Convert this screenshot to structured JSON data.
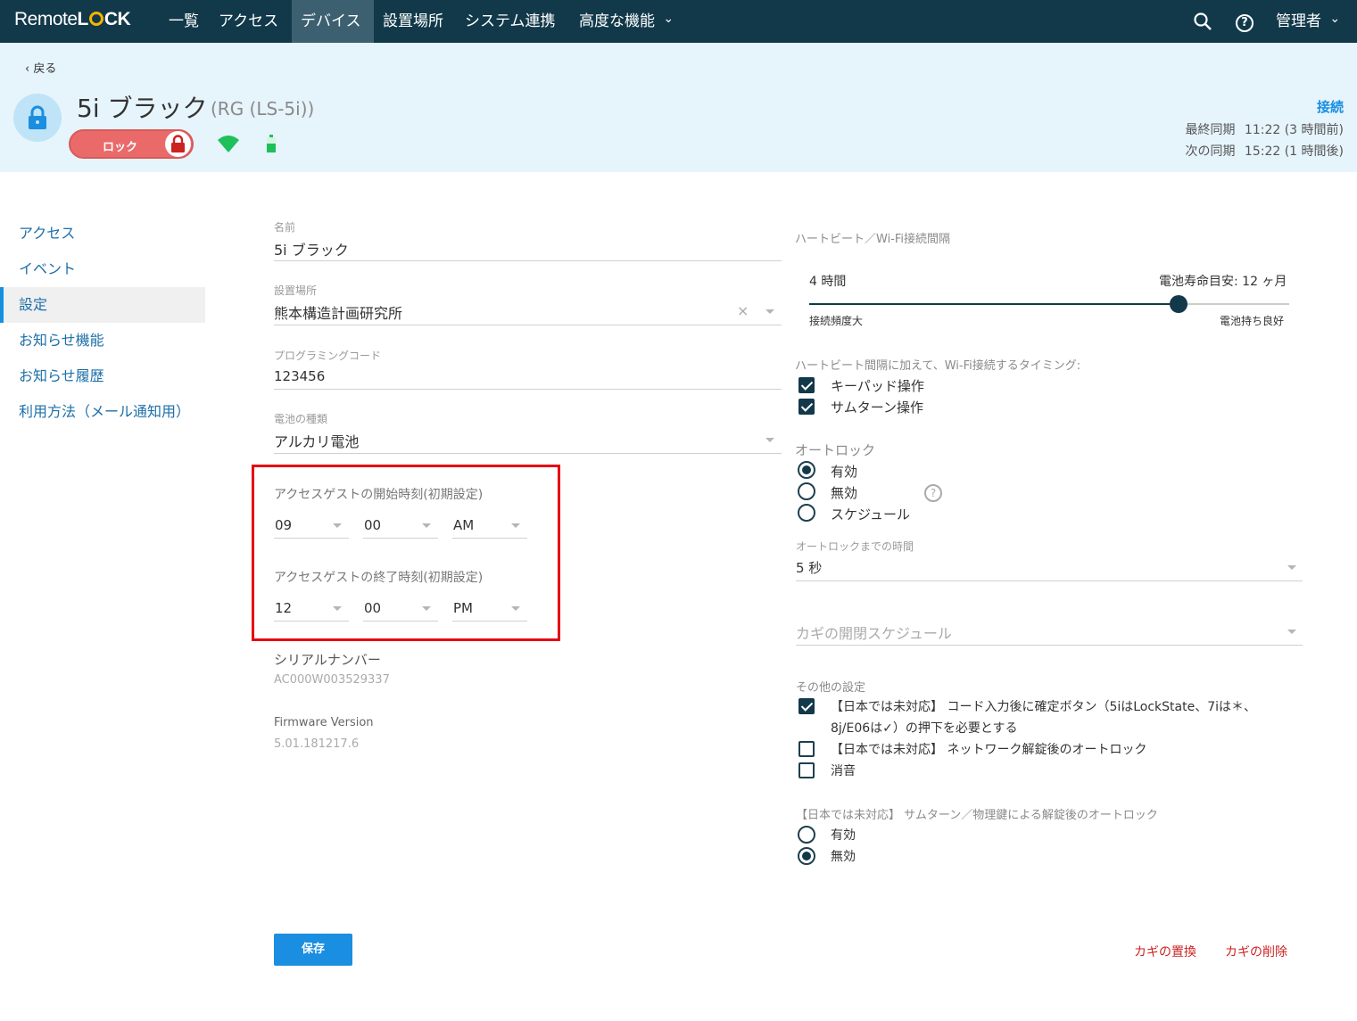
{
  "nav": {
    "logo_a": "Remote",
    "logo_b": "L",
    "logo_c": "CK",
    "items": [
      "一覧",
      "アクセス",
      "デバイス",
      "設置場所",
      "システム連携",
      "高度な機能"
    ],
    "advanced_caret": "⌄",
    "user": "管理者",
    "user_caret": "⌄",
    "help": "?"
  },
  "header": {
    "back": "戻る",
    "device_name": "5i ブラック",
    "device_model": "(RG (LS-5i))",
    "lock_label": "ロック",
    "connection": "接続",
    "last_sync_label": "最終同期",
    "last_sync_value": "11:22 (3 時間前)",
    "next_sync_label": "次の同期",
    "next_sync_value": "15:22 (1 時間後)"
  },
  "sidebar": {
    "items": [
      "アクセス",
      "イベント",
      "設定",
      "お知らせ機能",
      "お知らせ履歴",
      "利用方法（メール通知用）"
    ],
    "active": "設定"
  },
  "form": {
    "name_label": "名前",
    "name_value": "5i ブラック",
    "location_label": "設置場所",
    "location_value": "熊本構造計画研究所",
    "program_code_label": "プログラミングコード",
    "program_code_value": "123456",
    "battery_label": "電池の種類",
    "battery_value": "アルカリ電池",
    "guest_start_label": "アクセスゲストの開始時刻(初期設定)",
    "guest_start_hour": "09",
    "guest_start_min": "00",
    "guest_start_ampm": "AM",
    "guest_end_label": "アクセスゲストの終了時刻(初期設定)",
    "guest_end_hour": "12",
    "guest_end_min": "00",
    "guest_end_ampm": "PM",
    "serial_label": "シリアルナンバー",
    "serial_value": "AC000W003529337",
    "firmware_label": "Firmware Version",
    "firmware_value": "5.01.181217.6",
    "save_button": "保存"
  },
  "heartbeat": {
    "title": "ハートビート／Wi-Fi接続間隔",
    "interval": "4 時間",
    "battery_life": "電池寿命目安: 12 ヶ月",
    "left_label": "接続頻度大",
    "right_label": "電池持ち良好",
    "slider_level": 0.77,
    "timing_title": "ハートビート間隔に加えて、Wi-Fi接続するタイミング:",
    "keypad": "キーパッド操作",
    "thumbturn": "サムターン操作"
  },
  "autolock": {
    "title": "オートロック",
    "options": [
      "有効",
      "無効",
      "スケジュール"
    ],
    "selected": "有効",
    "help": "?",
    "delay_label": "オートロックまでの時間",
    "delay_value": "5 秒",
    "schedule_placeholder": "カギの開閉スケジュール"
  },
  "other": {
    "title": "その他の設定",
    "confirm_line1": "【日本では未対応】 コード入力後に確定ボタン（5iはLockState、7iは＊、",
    "confirm_line2": "8j/E06は✓）の押下を必要とする",
    "network_autolock": "【日本では未対応】 ネットワーク解錠後のオートロック",
    "mute": "消音",
    "thumbturn_title": "【日本では未対応】 サムターン／物理鍵による解錠後のオートロック",
    "thumbturn_options": [
      "有効",
      "無効"
    ],
    "thumbturn_selected": "無効"
  },
  "actions": {
    "replace_key": "カギの置換",
    "delete_key": "カギの削除"
  },
  "colors": {
    "nav_bg": "#12394a",
    "header_bg": "#e6f4fc",
    "accent": "#1a8ee0",
    "lock_red": "#ea6a6a",
    "highlight_box": "#e60012",
    "danger": "#cc2222"
  }
}
